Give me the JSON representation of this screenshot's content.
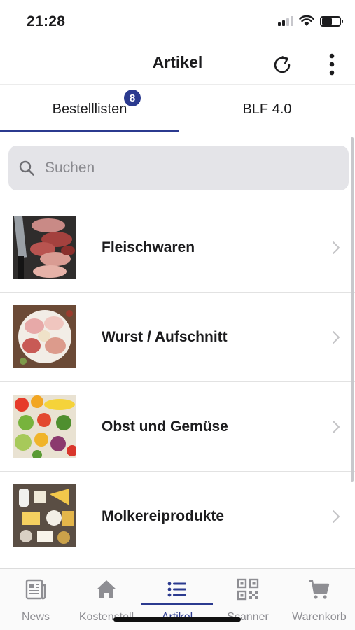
{
  "status_bar": {
    "time": "21:28"
  },
  "nav": {
    "title": "Artikel",
    "refresh_icon": "refresh-icon",
    "more_icon": "more-vertical-icon"
  },
  "tabs": [
    {
      "label": "Bestelllisten",
      "badge": "8",
      "active": true
    },
    {
      "label": "BLF 4.0",
      "active": false
    }
  ],
  "search": {
    "placeholder": "Suchen",
    "value": ""
  },
  "categories": [
    {
      "label": "Fleischwaren",
      "image": "meat-photo"
    },
    {
      "label": "Wurst / Aufschnitt",
      "image": "cold-cuts-photo"
    },
    {
      "label": "Obst und Gemüse",
      "image": "fruit-vegetables-photo"
    },
    {
      "label": "Molkereiprodukte",
      "image": "dairy-photo"
    }
  ],
  "tabbar": [
    {
      "label": "News",
      "icon": "news-icon",
      "active": false
    },
    {
      "label": "Kostenstell",
      "icon": "home-icon",
      "active": false
    },
    {
      "label": "Artikel",
      "icon": "list-icon",
      "active": true
    },
    {
      "label": "Scanner",
      "icon": "qr-code-icon",
      "active": false
    },
    {
      "label": "Warenkorb",
      "icon": "cart-icon",
      "active": false
    }
  ],
  "colors": {
    "accent": "#2b3a8f",
    "search_bg": "#e4e4e8",
    "inactive": "#8e8e93"
  }
}
